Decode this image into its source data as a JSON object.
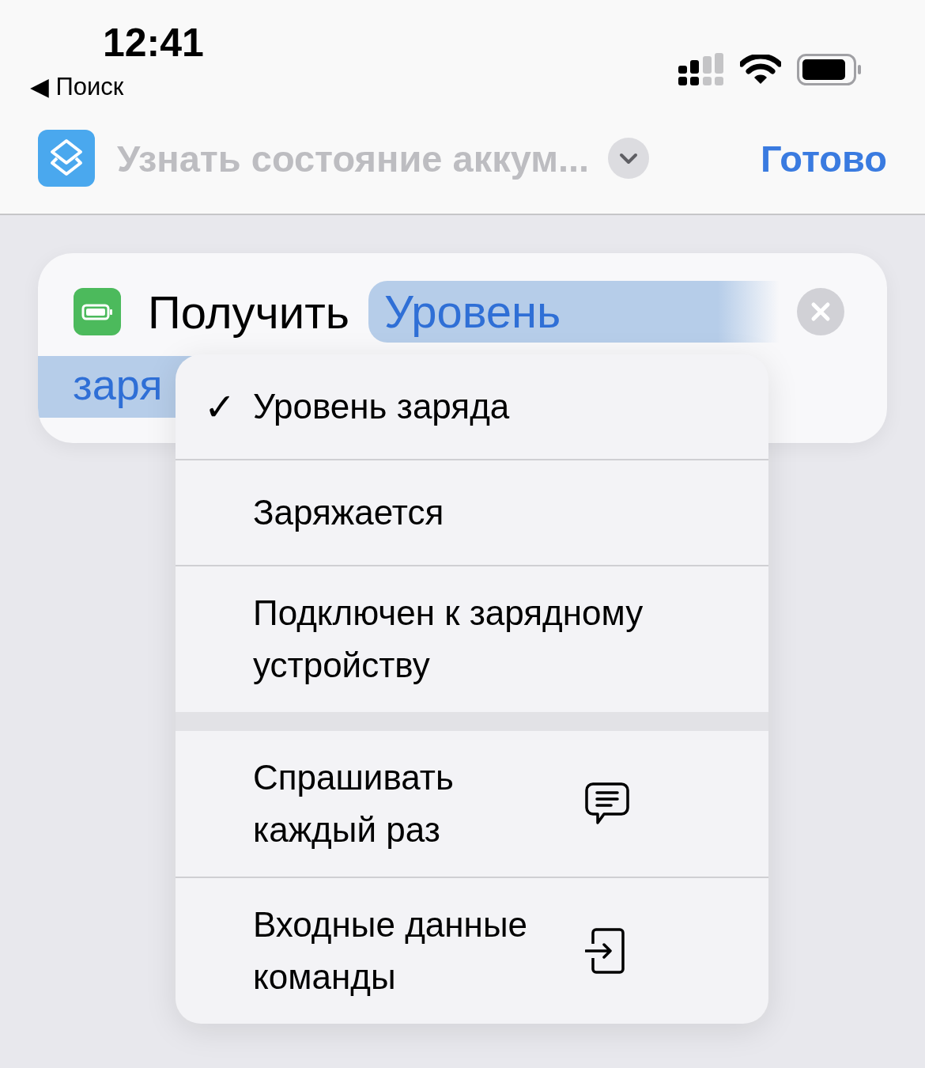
{
  "status_bar": {
    "time": "12:41",
    "back_label": "◀ Поиск"
  },
  "nav_bar": {
    "title": "Узнать состояние аккум...",
    "done": "Готово"
  },
  "action": {
    "verb": "Получить",
    "parameter_line_1": "Уровень",
    "parameter_line_2": "заря"
  },
  "menu": {
    "check": "✓",
    "sections": [
      [
        {
          "label": "Уровень заряда",
          "selected": true
        },
        {
          "label": "Заряжается",
          "selected": false
        },
        {
          "label": "Подключен к зарядному устройству",
          "selected": false
        }
      ],
      [
        {
          "label": "Спрашивать каждый раз",
          "kind": "ask"
        },
        {
          "label": "Входные данные команды",
          "kind": "input"
        }
      ]
    ]
  }
}
